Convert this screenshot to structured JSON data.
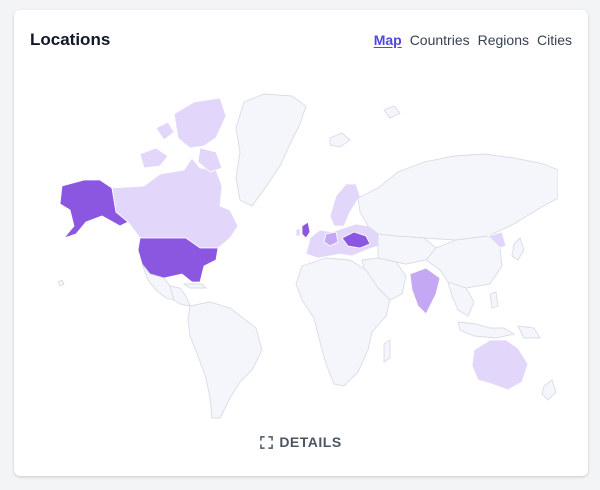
{
  "card": {
    "title": "Locations"
  },
  "tabs": [
    {
      "label": "Map",
      "active": true
    },
    {
      "label": "Countries",
      "active": false
    },
    {
      "label": "Regions",
      "active": false
    },
    {
      "label": "Cities",
      "active": false
    }
  ],
  "details": {
    "label": "DETAILS",
    "icon": "expand-icon"
  },
  "colors": {
    "accent": "#4f46e5",
    "land": "#f5f6fb",
    "level1": "#e3d6fb",
    "level2": "#c5a8f4",
    "level3": "#a677ea",
    "level4": "#8b57e0"
  }
}
